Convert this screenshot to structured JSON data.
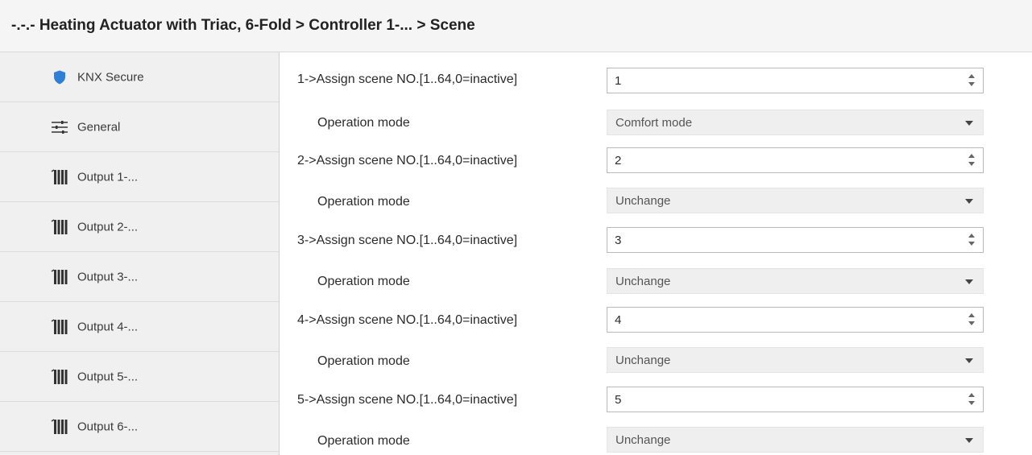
{
  "header": {
    "title": "-.-.- Heating Actuator with Triac, 6-Fold > Controller 1-... > Scene"
  },
  "sidebar": {
    "items": [
      {
        "label": "KNX Secure",
        "icon": "shield-icon"
      },
      {
        "label": "General",
        "icon": "sliders-icon"
      },
      {
        "label": "Output 1-...",
        "icon": "radiator-icon"
      },
      {
        "label": "Output 2-...",
        "icon": "radiator-icon"
      },
      {
        "label": "Output 3-...",
        "icon": "radiator-icon"
      },
      {
        "label": "Output 4-...",
        "icon": "radiator-icon"
      },
      {
        "label": "Output 5-...",
        "icon": "radiator-icon"
      },
      {
        "label": "Output 6-...",
        "icon": "radiator-icon"
      }
    ]
  },
  "scenes": [
    {
      "label": "1->Assign scene NO.[1..64,0=inactive]",
      "value": "1",
      "mode_label": "Operation mode",
      "mode_value": "Comfort mode"
    },
    {
      "label": "2->Assign scene NO.[1..64,0=inactive]",
      "value": "2",
      "mode_label": "Operation mode",
      "mode_value": "Unchange"
    },
    {
      "label": "3->Assign scene NO.[1..64,0=inactive]",
      "value": "3",
      "mode_label": "Operation mode",
      "mode_value": "Unchange"
    },
    {
      "label": "4->Assign scene NO.[1..64,0=inactive]",
      "value": "4",
      "mode_label": "Operation mode",
      "mode_value": "Unchange"
    },
    {
      "label": "5->Assign scene NO.[1..64,0=inactive]",
      "value": "5",
      "mode_label": "Operation mode",
      "mode_value": "Unchange"
    }
  ],
  "colors": {
    "shield": "#2f7fd6",
    "sidebar_bg": "#f0f0f0",
    "select_bg": "#efefef"
  }
}
